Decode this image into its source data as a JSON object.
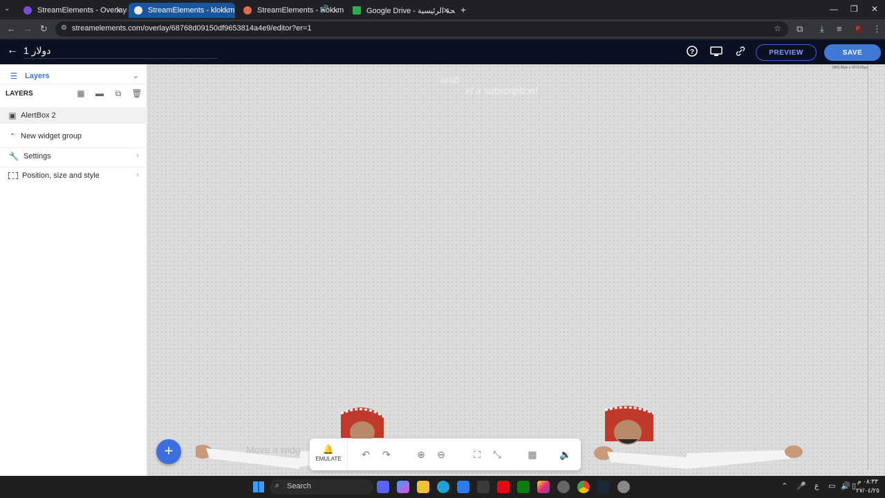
{
  "browser": {
    "tabs": [
      {
        "label": "StreamElements - Overlays",
        "color": "#7b4cd6"
      },
      {
        "label": "StreamElements - klokl.m",
        "color": "#7b4cd6"
      },
      {
        "label": "StreamElements - klokl.m",
        "color": "#e06a4a"
      },
      {
        "label": "Google Drive - الصفحة الرئيسية",
        "color": "#34a853"
      }
    ],
    "new_tab": "+",
    "url": "streamelements.com/overlay/68768d09150df9653814a4e9/editor?er=1"
  },
  "app": {
    "overlay_title": "دولار 1",
    "preview_label": "PREVIEW",
    "save_label": "SAVE"
  },
  "sidebar": {
    "panel_title": "Layers",
    "layers_heading": "LAYERS",
    "layer_item": "AlertBox 2",
    "group_label": "New widget group",
    "settings_label": "Settings",
    "position_label": "Position, size and style"
  },
  "canvas": {
    "ghost_text_1": "arab",
    "ghost_text_2": "el a subscription!",
    "resolution": "1905.56px x 1079.56px",
    "hint_text": "Move a widg"
  },
  "toolbar": {
    "emulate_label": "EMULATE"
  },
  "taskbar": {
    "search_label": "Search",
    "time": "٠٨:٣٣ م",
    "date": "٢٧/٠٤/٢٥",
    "lang": "ع"
  },
  "colors": {
    "header_bg": "#0c1023",
    "accent": "#3f7bd6",
    "canvas_bg": "#dcdcdc"
  }
}
